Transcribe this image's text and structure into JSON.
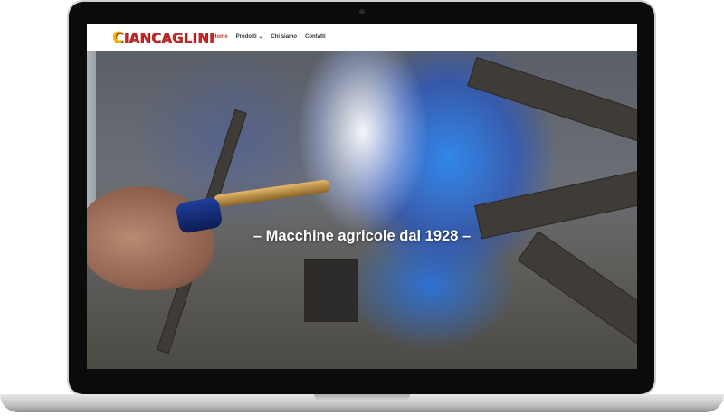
{
  "site": {
    "logo_first_letter": "C",
    "logo_rest": "IANCAGLINI"
  },
  "nav": {
    "items": [
      {
        "label": "Home",
        "active": true
      },
      {
        "label": "Prodotti ⌄",
        "active": false
      },
      {
        "label": "Chi siamo",
        "active": false
      },
      {
        "label": "Contatti",
        "active": false
      }
    ]
  },
  "hero": {
    "tagline": "– Macchine agricole dal 1928 –"
  },
  "colors": {
    "accent": "#c0392b",
    "logo_red": "#c62828",
    "logo_yellow": "#f2b705"
  }
}
